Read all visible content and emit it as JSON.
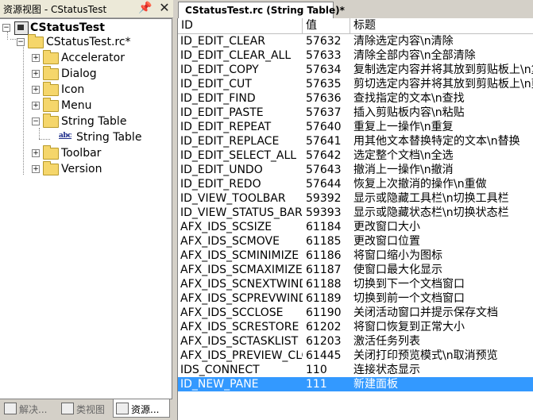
{
  "left_panel": {
    "title": "资源视图 - CStatusTest",
    "tree": {
      "root": "CStatusTest",
      "rc_file": "CStatusTest.rc*",
      "folders": [
        "Accelerator",
        "Dialog",
        "Icon",
        "Menu",
        "String Table",
        "Toolbar",
        "Version"
      ],
      "string_table_child": "String Table"
    },
    "tabs": [
      "解决...",
      "类视图",
      "资源..."
    ]
  },
  "editor": {
    "tab_title": "CStatusTest.rc (String Table)*",
    "columns": [
      "ID",
      "值",
      "标题"
    ],
    "rows": [
      {
        "id": "ID_EDIT_CLEAR",
        "value": "57632",
        "caption": "清除选定内容\\n清除"
      },
      {
        "id": "ID_EDIT_CLEAR_ALL",
        "value": "57633",
        "caption": "清除全部内容\\n全部清除"
      },
      {
        "id": "ID_EDIT_COPY",
        "value": "57634",
        "caption": "复制选定内容并将其放到剪贴板上\\n复制"
      },
      {
        "id": "ID_EDIT_CUT",
        "value": "57635",
        "caption": "剪切选定内容并将其放到剪贴板上\\n剪切"
      },
      {
        "id": "ID_EDIT_FIND",
        "value": "57636",
        "caption": "查找指定的文本\\n查找"
      },
      {
        "id": "ID_EDIT_PASTE",
        "value": "57637",
        "caption": "插入剪贴板内容\\n粘贴"
      },
      {
        "id": "ID_EDIT_REPEAT",
        "value": "57640",
        "caption": "重复上一操作\\n重复"
      },
      {
        "id": "ID_EDIT_REPLACE",
        "value": "57641",
        "caption": "用其他文本替换特定的文本\\n替换"
      },
      {
        "id": "ID_EDIT_SELECT_ALL",
        "value": "57642",
        "caption": "选定整个文档\\n全选"
      },
      {
        "id": "ID_EDIT_UNDO",
        "value": "57643",
        "caption": "撤消上一操作\\n撤消"
      },
      {
        "id": "ID_EDIT_REDO",
        "value": "57644",
        "caption": "恢复上次撤消的操作\\n重做"
      },
      {
        "id": "ID_VIEW_TOOLBAR",
        "value": "59392",
        "caption": "显示或隐藏工具栏\\n切换工具栏"
      },
      {
        "id": "ID_VIEW_STATUS_BAR",
        "value": "59393",
        "caption": "显示或隐藏状态栏\\n切换状态栏"
      },
      {
        "id": "AFX_IDS_SCSIZE",
        "value": "61184",
        "caption": "更改窗口大小"
      },
      {
        "id": "AFX_IDS_SCMOVE",
        "value": "61185",
        "caption": "更改窗口位置"
      },
      {
        "id": "AFX_IDS_SCMINIMIZE",
        "value": "61186",
        "caption": "将窗口缩小为图标"
      },
      {
        "id": "AFX_IDS_SCMAXIMIZE",
        "value": "61187",
        "caption": "使窗口最大化显示"
      },
      {
        "id": "AFX_IDS_SCNEXTWINDO...",
        "value": "61188",
        "caption": "切换到下一个文档窗口"
      },
      {
        "id": "AFX_IDS_SCPREVWINDO...",
        "value": "61189",
        "caption": "切换到前一个文档窗口"
      },
      {
        "id": "AFX_IDS_SCCLOSE",
        "value": "61190",
        "caption": "关闭活动窗口并提示保存文档"
      },
      {
        "id": "AFX_IDS_SCRESTORE",
        "value": "61202",
        "caption": "将窗口恢复到正常大小"
      },
      {
        "id": "AFX_IDS_SCTASKLIST",
        "value": "61203",
        "caption": "激活任务列表"
      },
      {
        "id": "AFX_IDS_PREVIEW_CLOSE",
        "value": "61445",
        "caption": "关闭打印预览模式\\n取消预览"
      },
      {
        "id": "IDS_CONNECT",
        "value": "110",
        "caption": "连接状态显示"
      },
      {
        "id": "ID_NEW_PANE",
        "value": "111",
        "caption": "新建面板"
      }
    ],
    "selected_index": 24
  }
}
